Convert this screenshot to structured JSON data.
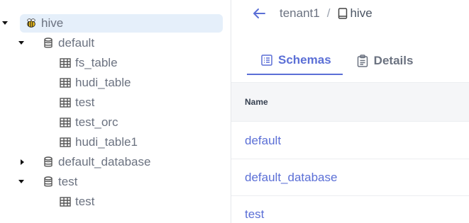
{
  "tree": {
    "root": {
      "label": "hive",
      "icon": "hive-bee-icon"
    },
    "nodes": [
      {
        "label": "default",
        "icon": "database-icon",
        "expanded": true
      },
      {
        "label": "fs_table",
        "icon": "table-icon"
      },
      {
        "label": "hudi_table",
        "icon": "table-icon"
      },
      {
        "label": "test",
        "icon": "table-icon"
      },
      {
        "label": "test_orc",
        "icon": "table-icon"
      },
      {
        "label": "hudi_table1",
        "icon": "table-icon"
      },
      {
        "label": "default_database",
        "icon": "database-icon",
        "expanded": false
      },
      {
        "label": "test",
        "icon": "database-icon",
        "expanded": true
      },
      {
        "label": "test",
        "icon": "table-icon"
      }
    ]
  },
  "breadcrumb": {
    "parent": "tenant1",
    "separator": "/",
    "current": "hive"
  },
  "tabs": [
    {
      "label": "Schemas",
      "icon": "schemas-list-icon",
      "active": true
    },
    {
      "label": "Details",
      "icon": "clipboard-icon",
      "active": false
    }
  ],
  "table": {
    "header": "Name",
    "rows": [
      "default",
      "default_database",
      "test"
    ]
  },
  "colors": {
    "accent": "#5b6fd6",
    "selected_bg": "#e5effa",
    "muted_text": "#6b7280"
  }
}
